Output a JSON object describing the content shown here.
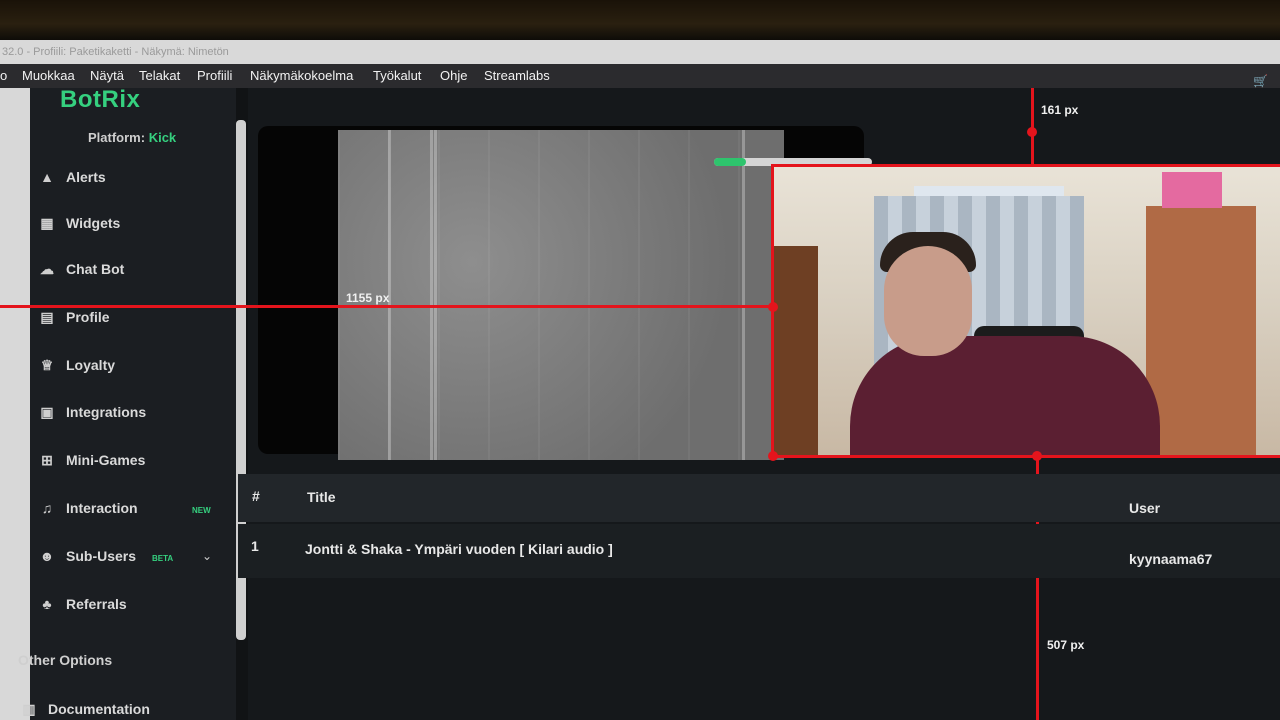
{
  "window": {
    "title": "32.0 - Profiili: Paketikaketti - Näkymä: Nimetön"
  },
  "menu": [
    {
      "label": "o"
    },
    {
      "label": "Muokkaa"
    },
    {
      "label": "Näytä"
    },
    {
      "label": "Telakat"
    },
    {
      "label": "Profiili"
    },
    {
      "label": "Näkymäkokoelma"
    },
    {
      "label": "Työkalut"
    },
    {
      "label": "Ohje"
    },
    {
      "label": "Streamlabs"
    }
  ],
  "brand": {
    "logo": "BotRix",
    "accent": "#35d07f"
  },
  "platform": {
    "label": "Platform:",
    "value": "Kick"
  },
  "sidebar": {
    "items": [
      {
        "label": "Alerts",
        "icon": "warning-icon"
      },
      {
        "label": "Widgets",
        "icon": "widgets-icon"
      },
      {
        "label": "Chat Bot",
        "icon": "bot-icon"
      },
      {
        "label": "Profile",
        "icon": "profile-card-icon"
      },
      {
        "label": "Loyalty",
        "icon": "trophy-icon"
      },
      {
        "label": "Integrations",
        "icon": "integrations-icon"
      },
      {
        "label": "Mini-Games",
        "icon": "gamepad-icon"
      },
      {
        "label": "Interaction",
        "icon": "music-note-icon",
        "badge": "NEW"
      },
      {
        "label": "Sub-Users",
        "icon": "users-icon",
        "badge": "BETA"
      },
      {
        "label": "Referrals",
        "icon": "referrals-icon"
      }
    ],
    "other_options": "Other Options",
    "documentation": "Documentation"
  },
  "measure": {
    "horizontal": "1155 px",
    "top": "161 px",
    "bottom": "507 px"
  },
  "table": {
    "headers": {
      "num": "#",
      "title": "Title",
      "user": "User"
    },
    "rows": [
      {
        "num": "1",
        "title": "Jontti & Shaka - Ympäri vuoden [ Kilari audio ]",
        "user": "kyynaama67"
      }
    ]
  }
}
